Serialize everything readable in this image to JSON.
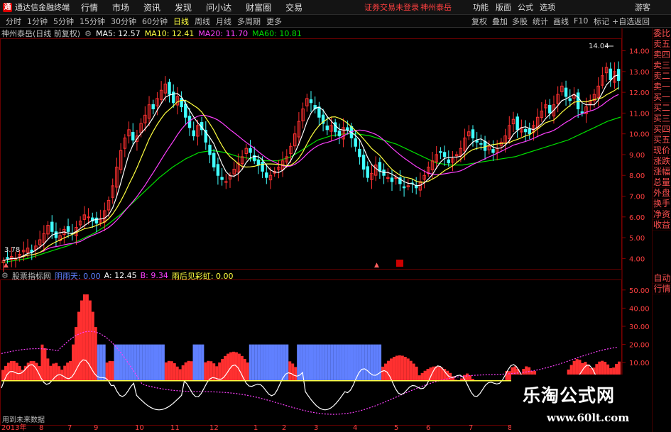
{
  "menubar": {
    "app_title": "通达信金融终端",
    "items": [
      "行情",
      "市场",
      "资讯",
      "发现",
      "问小达",
      "财富圈",
      "交易"
    ],
    "notice": "证券交易未登录",
    "stock": "神州泰岳",
    "right_items": [
      "功能",
      "版面",
      "公式",
      "选项",
      "游客"
    ]
  },
  "periodbar": {
    "periods": [
      "分时",
      "1分钟",
      "5分钟",
      "15分钟",
      "30分钟",
      "60分钟",
      "日线",
      "周线",
      "月线",
      "多周期",
      "更多"
    ],
    "active": "日线",
    "tools": [
      "复权",
      "叠加",
      "多股",
      "统计",
      "画线",
      "F10",
      "标记",
      "+自选",
      "返回"
    ]
  },
  "main_info": {
    "title": "神州泰岳(日线 前复权)",
    "ma5": "MA5: 12.57",
    "ma10": "MA10: 12.41",
    "ma20": "MA20: 11.70",
    "ma60": "MA60: 10.81"
  },
  "colors": {
    "ma5": "#ffffff",
    "ma10": "#ffff40",
    "ma20": "#ff40ff",
    "ma60": "#00e000",
    "up": "#ff3030",
    "down": "#40ffff",
    "blue_bar": "#6080ff"
  },
  "right_tabs": [
    "委比",
    "卖五",
    "卖四",
    "卖三",
    "卖二",
    "卖一",
    "买一",
    "买二",
    "买三",
    "买四",
    "买五",
    "现价",
    "涨跌",
    "涨幅",
    "总量",
    "外盘",
    "换手",
    "净资",
    "收益"
  ],
  "right_tabs_lower": [
    "自动",
    "行情"
  ],
  "price_axis": [
    "14.00",
    "13.00",
    "12.00",
    "11.00",
    "10.00",
    "9.00",
    "8.00",
    "7.00",
    "6.00",
    "5.00",
    "4.00"
  ],
  "price_marks": {
    "high": "14.04",
    "low": "3.78"
  },
  "indicator": {
    "name": "股票指标网",
    "label1": "阴雨天: 0.00",
    "label2": "A: 12.45",
    "label3": "B: 9.34",
    "label4": "雨后见彩虹: 0.00"
  },
  "ind_axis": [
    "50.00",
    "40.00",
    "30.00",
    "20.00",
    "10.00"
  ],
  "date_axis": [
    "2013年",
    "8",
    "7",
    "9",
    "10",
    "11",
    "12",
    "1",
    "2",
    "3",
    "4",
    "5",
    "6",
    "7",
    "8"
  ],
  "footnote": "用到未来数据",
  "watermark": {
    "line1": "乐淘公式网",
    "line2": "www.60lt.com"
  },
  "chart_data": {
    "type": "candlestick",
    "price_range": [
      3.5,
      14.6
    ],
    "closes": [
      3.9,
      4.0,
      4.1,
      4.0,
      4.2,
      4.4,
      4.5,
      4.3,
      4.6,
      4.9,
      5.2,
      5.6,
      5.3,
      5.0,
      5.1,
      5.4,
      5.3,
      5.2,
      5.5,
      5.8,
      6.1,
      6.0,
      5.8,
      5.7,
      5.9,
      6.3,
      6.8,
      7.5,
      8.4,
      9.2,
      9.8,
      10.2,
      9.7,
      9.9,
      10.5,
      10.9,
      11.4,
      11.2,
      11.7,
      12.1,
      12.4,
      11.9,
      11.5,
      11.8,
      11.3,
      10.8,
      10.3,
      9.9,
      10.4,
      10.2,
      9.6,
      9.0,
      8.4,
      8.0,
      7.8,
      7.7,
      8.0,
      8.3,
      8.6,
      8.9,
      9.3,
      9.1,
      8.7,
      8.5,
      8.2,
      7.9,
      8.0,
      8.2,
      8.4,
      8.7,
      8.9,
      9.4,
      10.0,
      10.6,
      11.2,
      11.7,
      11.5,
      11.2,
      10.8,
      10.5,
      10.2,
      10.4,
      10.1,
      9.9,
      10.3,
      10.2,
      9.8,
      9.4,
      8.9,
      8.3,
      7.9,
      8.1,
      8.5,
      8.2,
      8.0,
      7.9,
      7.7,
      7.9,
      7.6,
      7.4,
      7.5,
      7.6,
      7.4,
      7.7,
      8.0,
      8.4,
      8.7,
      9.0,
      9.1,
      8.9,
      8.6,
      8.8,
      9.0,
      9.3,
      9.8,
      10.1,
      9.8,
      9.6,
      9.5,
      9.2,
      9.4,
      9.1,
      9.3,
      9.6,
      9.9,
      10.4,
      10.7,
      10.2,
      10.3,
      10.1,
      10.0,
      10.4,
      10.8,
      11.1,
      11.4,
      11.0,
      11.4,
      11.9,
      12.3,
      11.8,
      11.6,
      11.9,
      11.2,
      11.0,
      11.3,
      11.6,
      11.9,
      12.3,
      12.8,
      13.2,
      12.6,
      13.0,
      12.57
    ],
    "ma60": [
      3.8,
      3.9,
      4.0,
      4.2,
      4.4,
      4.6,
      4.9,
      5.2,
      5.6,
      6.1,
      6.7,
      7.3,
      7.9,
      8.4,
      8.8,
      9.1,
      9.2,
      9.1,
      8.9,
      8.8,
      8.7,
      8.7,
      8.9,
      9.3,
      9.7,
      9.9,
      10.0,
      10.0,
      9.9,
      9.7,
      9.5,
      9.2,
      8.9,
      8.6,
      8.5,
      8.5,
      8.6,
      8.7,
      8.8,
      8.9,
      9.1,
      9.3,
      9.5,
      9.7,
      10.0,
      10.3,
      10.6,
      10.81
    ],
    "indicator_range": [
      -20,
      55
    ]
  }
}
